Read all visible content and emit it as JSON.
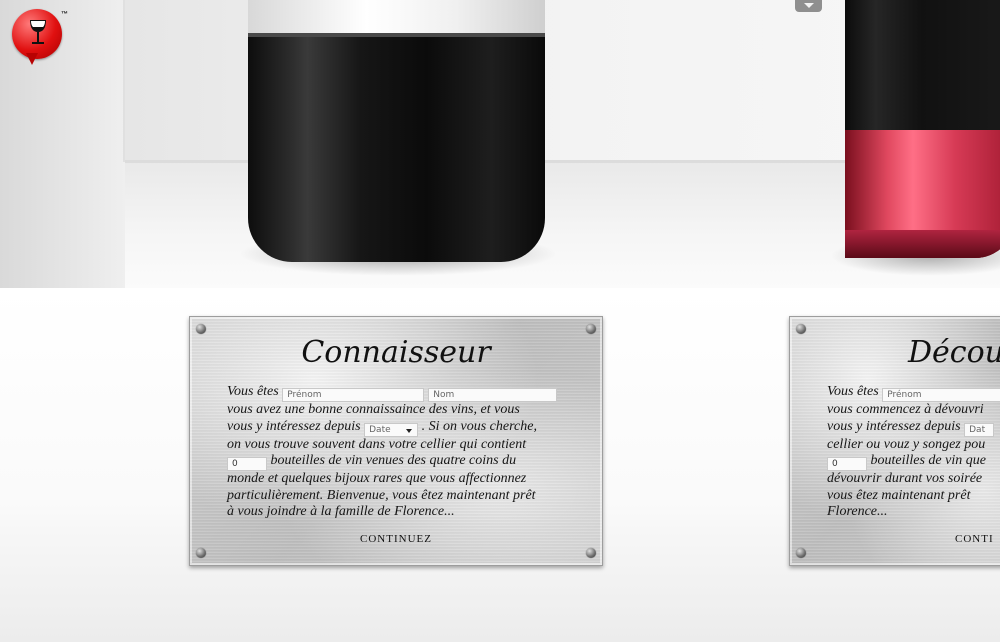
{
  "brand": {
    "tm": "™"
  },
  "plates": [
    {
      "title": "Connaisseur",
      "lines": {
        "l1_pre": "Vous êtes",
        "l2": "vous avez une bonne connaissaince des vins, et vous",
        "l3_pre": "vous y intéressez depuis",
        "l3_post": ". Si on vous cherche,",
        "l4": "on vous trouve souvent dans votre cellier qui contient",
        "l5_post": "bouteilles de vin venues des quatre coins du",
        "l6": "monde et quelques bijoux rares que vous affectionnez",
        "l7": "particulièrement. Bienvenue, vous êtez maintenant prêt",
        "l8": "à vous joindre à la famille de Florence..."
      },
      "fields": {
        "prenom": "Prénom",
        "nom": "Nom",
        "date": "Date",
        "qty": "0"
      },
      "continue": "CONTINUEZ"
    },
    {
      "title": "Décou",
      "lines": {
        "l1_pre": "Vous êtes",
        "l2": "vous commencez à dévouvri",
        "l3_pre": "vous y intéressez depuis",
        "l4": "cellier ou vouz y songez pou",
        "l5_post": "bouteilles de vin que",
        "l6": "dévouvrir durant vos soirée",
        "l7": "vous êtez maintenant prêt",
        "l8": "Florence..."
      },
      "fields": {
        "prenom": "Prénom",
        "date": "Dat",
        "qty": "0"
      },
      "continue": "CONTI"
    }
  ]
}
